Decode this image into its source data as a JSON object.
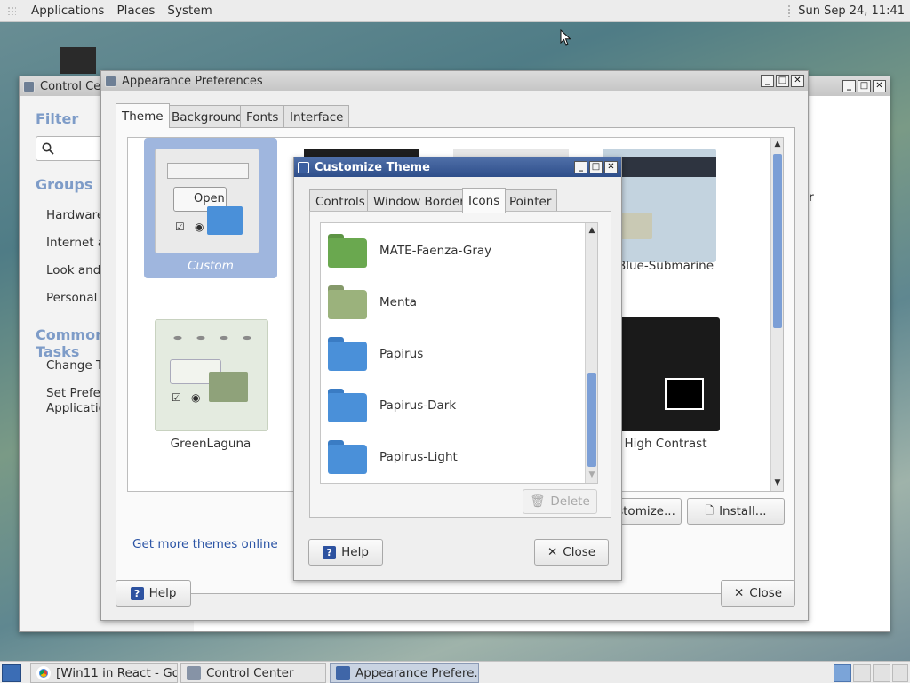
{
  "top_panel": {
    "menus": [
      "Applications",
      "Places",
      "System"
    ],
    "clock": "Sun Sep 24, 11:41"
  },
  "control_center": {
    "title": "Control Center",
    "filter_heading": "Filter",
    "groups_heading": "Groups",
    "groups": [
      "Hardware",
      "Internet and Network",
      "Look and Feel",
      "Personal"
    ],
    "common_heading": "Common Tasks",
    "tasks": [
      "Change Theme",
      "Set Preferred Applications"
    ],
    "right_fragment": "er"
  },
  "appearance": {
    "title": "Appearance Preferences",
    "tabs": [
      "Theme",
      "Background",
      "Fonts",
      "Interface"
    ],
    "themes": [
      {
        "label": "Custom"
      },
      {
        "label": "Blue-Submarine"
      },
      {
        "label": "GreenLaguna"
      },
      {
        "label": "High Contrast"
      }
    ],
    "preview_open": "Open",
    "more_link": "Get more themes online",
    "customize_button": "Customize...",
    "install_button": "Install...",
    "help_button": "Help",
    "close_button": "Close"
  },
  "customize": {
    "title": "Customize Theme",
    "tabs": [
      "Controls",
      "Window Border",
      "Icons",
      "Pointer"
    ],
    "icon_themes": [
      {
        "name": "MATE-Faenza-Gray",
        "color": "#6aa84f"
      },
      {
        "name": "Menta",
        "color": "#9bb27c"
      },
      {
        "name": "Papirus",
        "color": "#4a90d9"
      },
      {
        "name": "Papirus-Dark",
        "color": "#4a90d9"
      },
      {
        "name": "Papirus-Light",
        "color": "#4a90d9"
      }
    ],
    "delete_button": "Delete",
    "help_button": "Help",
    "close_button": "Close"
  },
  "taskbar": {
    "items": [
      "[Win11 in React - Go...",
      "Control Center",
      "Appearance Prefere..."
    ]
  },
  "colors": {
    "accent": "#2d52a0",
    "selection": "#9fb6de"
  }
}
